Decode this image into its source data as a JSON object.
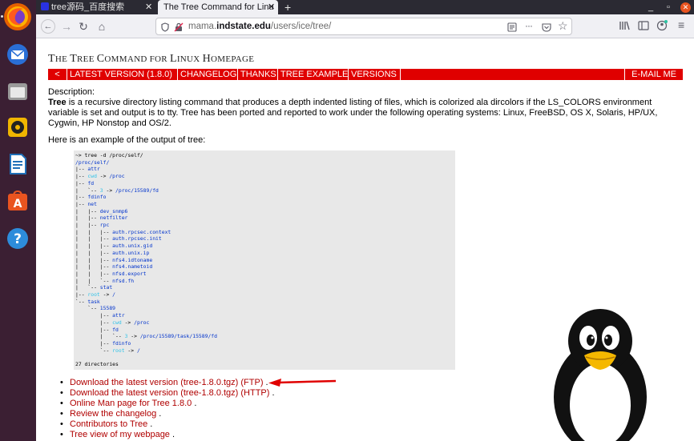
{
  "dock": {
    "apps": [
      {
        "name": "firefox-icon",
        "color": "#e66000"
      },
      {
        "name": "thunderbird-icon",
        "color": "#2a6fd6"
      },
      {
        "name": "files-icon",
        "color": "#8f8f8f"
      },
      {
        "name": "rhythmbox-icon",
        "color": "#f0b500"
      },
      {
        "name": "writer-icon",
        "color": "#1f6fb8"
      },
      {
        "name": "software-icon",
        "color": "#e95420"
      },
      {
        "name": "help-icon",
        "color": "#2d8cdb"
      }
    ]
  },
  "browser": {
    "tabs": [
      {
        "title": "tree源码_百度搜索",
        "active": false
      },
      {
        "title": "The Tree Command for Linu",
        "active": true
      }
    ],
    "new_tab_label": "+",
    "close_glyph": "✕",
    "url": {
      "prefix": "mama.",
      "domain": "indstate.edu",
      "path": "/users/ice/tree/"
    },
    "menu_dots": "···"
  },
  "page": {
    "title": {
      "parts": [
        [
          "T",
          "HE "
        ],
        [
          "T",
          "REE "
        ],
        [
          "C",
          "OMMAND FOR "
        ],
        [
          "L",
          "INUX "
        ],
        [
          "H",
          "OMEPAGE"
        ]
      ]
    },
    "menu": [
      {
        "label": "<"
      },
      {
        "label": "LATEST VERSION (1.8.0)"
      },
      {
        "label": "CHANGELOG"
      },
      {
        "label": "THANKS"
      },
      {
        "label": "TREE EXAMPLE"
      },
      {
        "label": "VERSIONS"
      }
    ],
    "email_label": "E-MAIL ME",
    "description_label": "Description:",
    "description_bold": "Tree",
    "description_text": " is a recursive directory listing command that produces a depth indented listing of files, which is colorized ala dircolors if the LS_COLORS environment variable is set and output is to tty. Tree has been ported and reported to work under the following operating systems: Linux, FreeBSD, OS X, Solaris, HP/UX, Cygwin, HP Nonstop and OS/2.",
    "example_label": "Here is an example of the output of tree:",
    "tree_output": [
      [
        [
          "",
          "~> tree -d /proc/self/"
        ]
      ],
      [
        [
          "d",
          "/proc/self/"
        ]
      ],
      [
        [
          "",
          "|-- "
        ],
        [
          "d",
          "attr"
        ]
      ],
      [
        [
          "",
          "|-- "
        ],
        [
          "c",
          "cwd"
        ],
        [
          "",
          " -> "
        ],
        [
          "d",
          "/proc"
        ]
      ],
      [
        [
          "",
          "|-- "
        ],
        [
          "d",
          "fd"
        ]
      ],
      [
        [
          "",
          "|   `-- "
        ],
        [
          "c",
          "3"
        ],
        [
          "",
          " -> "
        ],
        [
          "d",
          "/proc/15589/fd"
        ]
      ],
      [
        [
          "",
          "|-- "
        ],
        [
          "d",
          "fdinfo"
        ]
      ],
      [
        [
          "",
          "|-- "
        ],
        [
          "d",
          "net"
        ]
      ],
      [
        [
          "",
          "|   |-- "
        ],
        [
          "d",
          "dev_snmp6"
        ]
      ],
      [
        [
          "",
          "|   |-- "
        ],
        [
          "d",
          "netfilter"
        ]
      ],
      [
        [
          "",
          "|   |-- "
        ],
        [
          "d",
          "rpc"
        ]
      ],
      [
        [
          "",
          "|   |   |-- "
        ],
        [
          "d",
          "auth.rpcsec.context"
        ]
      ],
      [
        [
          "",
          "|   |   |-- "
        ],
        [
          "d",
          "auth.rpcsec.init"
        ]
      ],
      [
        [
          "",
          "|   |   |-- "
        ],
        [
          "d",
          "auth.unix.gid"
        ]
      ],
      [
        [
          "",
          "|   |   |-- "
        ],
        [
          "d",
          "auth.unix.ip"
        ]
      ],
      [
        [
          "",
          "|   |   |-- "
        ],
        [
          "d",
          "nfs4.idtoname"
        ]
      ],
      [
        [
          "",
          "|   |   |-- "
        ],
        [
          "d",
          "nfs4.nametoid"
        ]
      ],
      [
        [
          "",
          "|   |   |-- "
        ],
        [
          "d",
          "nfsd.export"
        ]
      ],
      [
        [
          "",
          "|   |   `-- "
        ],
        [
          "d",
          "nfsd.fh"
        ]
      ],
      [
        [
          "",
          "|   `-- "
        ],
        [
          "d",
          "stat"
        ]
      ],
      [
        [
          "",
          "|-- "
        ],
        [
          "c",
          "root"
        ],
        [
          "",
          " -> "
        ],
        [
          "d",
          "/"
        ]
      ],
      [
        [
          "",
          "`-- "
        ],
        [
          "d",
          "task"
        ]
      ],
      [
        [
          "",
          "    `-- "
        ],
        [
          "d",
          "15589"
        ]
      ],
      [
        [
          "",
          "        |-- "
        ],
        [
          "d",
          "attr"
        ]
      ],
      [
        [
          "",
          "        |-- "
        ],
        [
          "c",
          "cwd"
        ],
        [
          "",
          " -> "
        ],
        [
          "d",
          "/proc"
        ]
      ],
      [
        [
          "",
          "        |-- "
        ],
        [
          "d",
          "fd"
        ]
      ],
      [
        [
          "",
          "        |   `-- "
        ],
        [
          "c",
          "3"
        ],
        [
          "",
          " -> "
        ],
        [
          "d",
          "/proc/15589/task/15589/fd"
        ]
      ],
      [
        [
          "",
          "        |-- "
        ],
        [
          "d",
          "fdinfo"
        ]
      ],
      [
        [
          "",
          "        `-- "
        ],
        [
          "c",
          "root"
        ],
        [
          "",
          " -> "
        ],
        [
          "d",
          "/"
        ]
      ],
      [
        [
          "",
          ""
        ]
      ],
      [
        [
          "",
          "27 directories"
        ]
      ]
    ],
    "links": [
      {
        "label": "Download the latest version (tree-1.8.0.tgz) (FTP)"
      },
      {
        "label": "Download the latest version (tree-1.8.0.tgz) (HTTP)"
      },
      {
        "label": "Online Man page for Tree 1.8.0"
      },
      {
        "label": "Review the changelog"
      },
      {
        "label": "Contributors to Tree"
      },
      {
        "label": "Tree view of my webpage"
      }
    ],
    "colors": {
      "menu_bg": "#e00000",
      "link": "#b00000",
      "dir": "#0033cc",
      "link_target": "#33c3e8"
    }
  }
}
